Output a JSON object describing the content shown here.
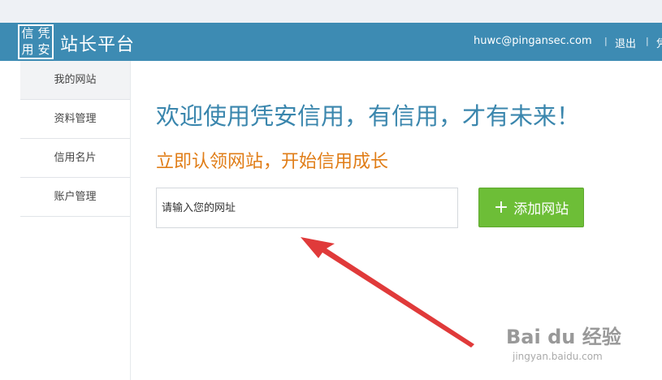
{
  "logo": {
    "chars": [
      "信",
      "凭",
      "用",
      "安"
    ]
  },
  "header": {
    "brand": "站长平台",
    "email": "huwc@pingansec.com",
    "separator": "|",
    "logout": "退出",
    "extra": "凭"
  },
  "sidebar": {
    "items": [
      {
        "label": "我的网站",
        "active": true
      },
      {
        "label": "资料管理",
        "active": false
      },
      {
        "label": "信用名片",
        "active": false
      },
      {
        "label": "账户管理",
        "active": false
      }
    ]
  },
  "main": {
    "welcome": "欢迎使用凭安信用，有信用，才有未来！",
    "subtitle": "立即认领网站，开始信用成长",
    "url_input": {
      "placeholder": "请输入您的网址",
      "value": ""
    },
    "add_button": {
      "icon": "plus-icon",
      "label": "添加网站"
    }
  },
  "watermark": {
    "text": "Bai du 经验",
    "url": "jingyan.baidu.com"
  },
  "colors": {
    "header": "#3d8bb3",
    "welcome": "#3a86ad",
    "subtitle": "#e07d17",
    "button": "#6dbe37",
    "arrow": "#e03a3a"
  }
}
